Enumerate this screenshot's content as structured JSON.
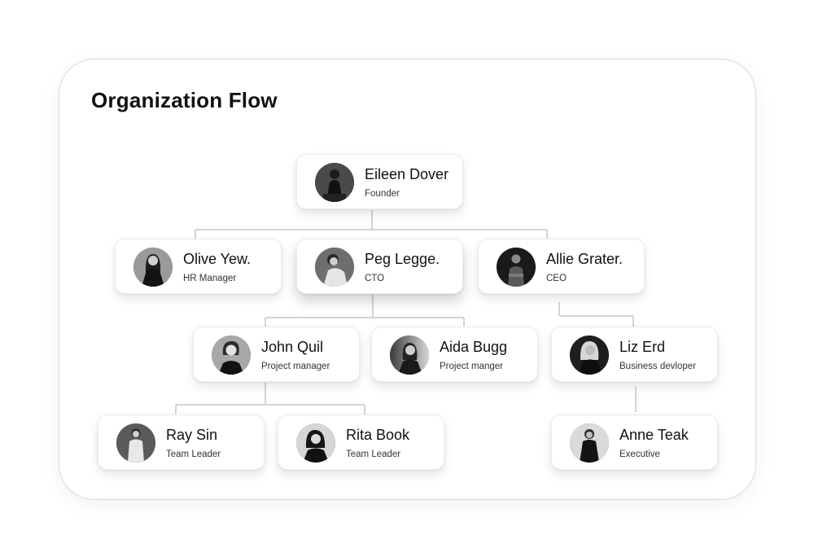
{
  "title": "Organization Flow",
  "colors": {
    "connector": "#d4d4d4",
    "card_bg": "#ffffff",
    "text": "#111111"
  },
  "people": [
    {
      "id": "eileen",
      "name": "Eileen Dover",
      "role": "Founder",
      "level": 0,
      "parent": null
    },
    {
      "id": "olive",
      "name": "Olive Yew.",
      "role": "HR Manager",
      "level": 1,
      "parent": "eileen"
    },
    {
      "id": "peg",
      "name": "Peg Legge.",
      "role": "CTO",
      "level": 1,
      "parent": "eileen"
    },
    {
      "id": "allie",
      "name": "Allie Grater.",
      "role": "CEO",
      "level": 1,
      "parent": "eileen"
    },
    {
      "id": "john",
      "name": "John Quil",
      "role": "Project manager",
      "level": 2,
      "parent": "peg"
    },
    {
      "id": "aida",
      "name": "Aida Bugg",
      "role": "Project manger",
      "level": 2,
      "parent": "peg"
    },
    {
      "id": "liz",
      "name": "Liz Erd",
      "role": "Business devloper",
      "level": 2,
      "parent": "allie"
    },
    {
      "id": "ray",
      "name": "Ray Sin",
      "role": "Team Leader",
      "level": 3,
      "parent": "john"
    },
    {
      "id": "rita",
      "name": "Rita Book",
      "role": "Team Leader",
      "level": 3,
      "parent": "john"
    },
    {
      "id": "anne",
      "name": "Anne Teak",
      "role": "Executive",
      "level": 3,
      "parent": "liz"
    }
  ]
}
